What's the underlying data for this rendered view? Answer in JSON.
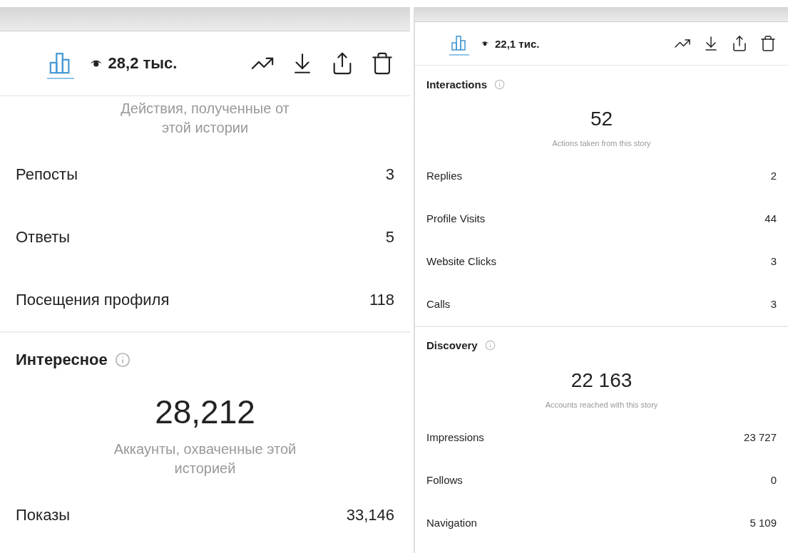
{
  "panels": [
    {
      "kind": "large",
      "toolbar": {
        "insights_tab": {
          "selected": true
        },
        "views": "28,2 тыс."
      },
      "sections": [
        {
          "caption": "Действия, полученные от этой истории",
          "rows": [
            {
              "label": "Репосты",
              "value": "3"
            },
            {
              "label": "Ответы",
              "value": "5"
            },
            {
              "label": "Посещения профиля",
              "value": "118"
            }
          ]
        },
        {
          "title": "Интересное",
          "total": "28,212",
          "caption": "Аккаунты, охваченные этой историей",
          "rows": [
            {
              "label": "Показы",
              "value": "33,146"
            }
          ]
        }
      ]
    },
    {
      "kind": "compact",
      "toolbar": {
        "insights_tab": {
          "selected": true
        },
        "views": "22,1 тис."
      },
      "sections": [
        {
          "title": "Interactions",
          "total": "52",
          "caption": "Actions taken from this story",
          "rows": [
            {
              "label": "Replies",
              "value": "2"
            },
            {
              "label": "Profile Visits",
              "value": "44"
            },
            {
              "label": "Website Clicks",
              "value": "3"
            },
            {
              "label": "Calls",
              "value": "3"
            }
          ]
        },
        {
          "title": "Discovery",
          "total": "22 163",
          "caption": "Accounts reached with this story",
          "rows": [
            {
              "label": "Impressions",
              "value": "23 727"
            },
            {
              "label": "Follows",
              "value": "0"
            },
            {
              "label": "Navigation",
              "value": "5 109"
            }
          ]
        }
      ]
    }
  ]
}
